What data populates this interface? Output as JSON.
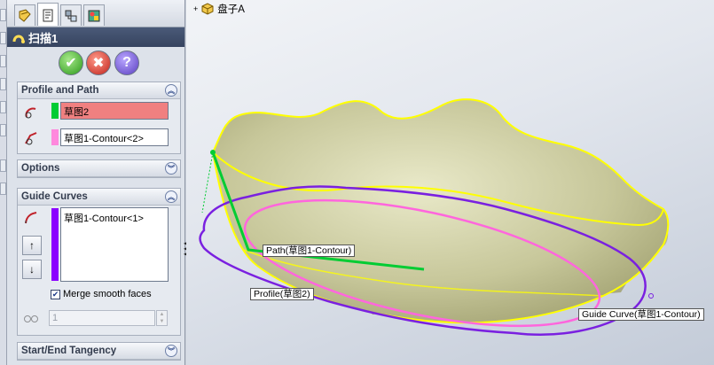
{
  "feature": {
    "title": "扫描1"
  },
  "tabs": [
    "feature-manager",
    "property-manager",
    "configuration-manager",
    "display-manager"
  ],
  "profile_and_path": {
    "header": "Profile and Path",
    "profile_value": "草图2",
    "path_value": "草图1-Contour<2>"
  },
  "options": {
    "header": "Options"
  },
  "guide_curves": {
    "header": "Guide Curves",
    "list_items": [
      "草图1-Contour<1>"
    ],
    "merge_smooth_label": "Merge smooth faces",
    "merge_smooth_checked": true,
    "spin_value": "1"
  },
  "tangency": {
    "header": "Start/End Tangency"
  },
  "tree": {
    "root_label": "盘子A"
  },
  "callouts": {
    "path": "Path(草图1-Contour)",
    "profile": "Profile(草图2)",
    "guide": "Guide Curve(草图1-Contour)"
  },
  "colors": {
    "profile_highlight": "#f08080",
    "path_swatch": "#ff88dd",
    "guide_swatch": "#8b00ff",
    "profile_swatch": "#00cc33",
    "edge_yellow": "#ffff00",
    "guide_curve": "#7a20e0",
    "path_curve": "#ff66dd"
  }
}
